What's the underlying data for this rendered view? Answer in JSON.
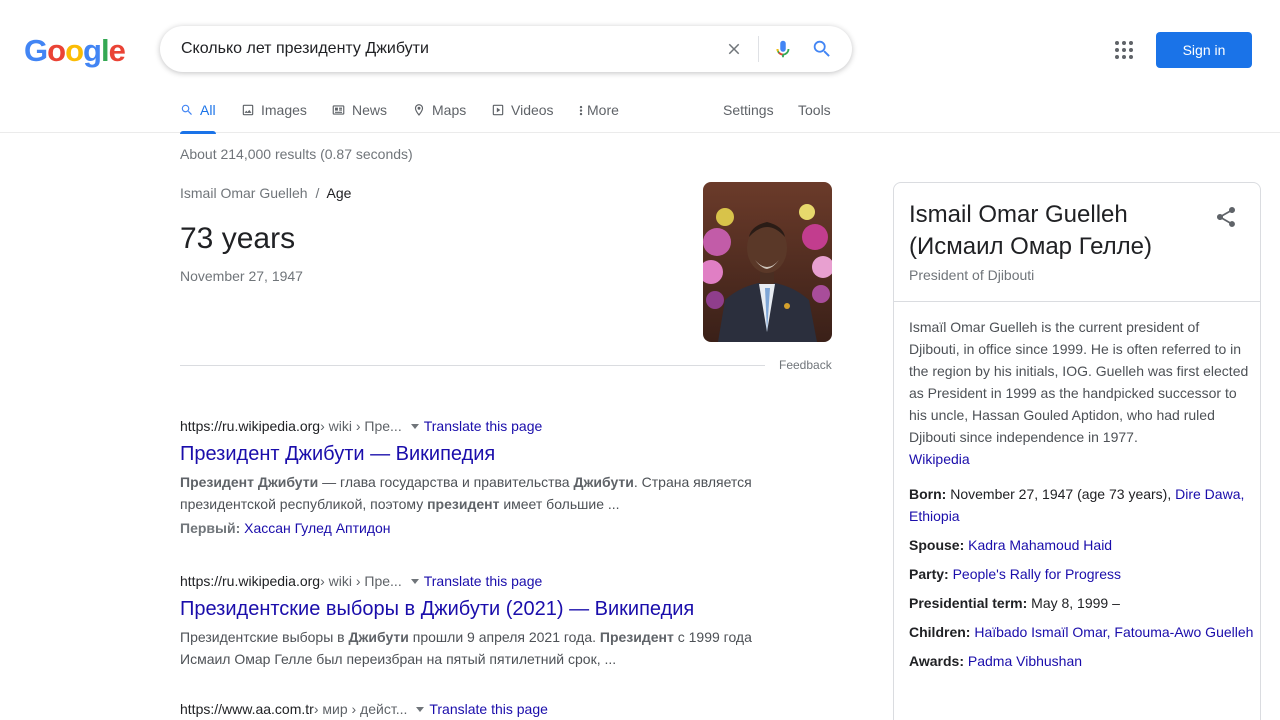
{
  "logo": {
    "text": "Google",
    "colors": [
      "#4285F4",
      "#EA4335",
      "#FBBC05",
      "#4285F4",
      "#34A853",
      "#EA4335"
    ]
  },
  "search": {
    "query": "Сколько лет президенту Джибути"
  },
  "header": {
    "signin_label": "Sign in"
  },
  "tabs": [
    {
      "label": "All",
      "icon": "search-icon",
      "active": true
    },
    {
      "label": "Images",
      "icon": "image-icon"
    },
    {
      "label": "News",
      "icon": "newspaper-icon"
    },
    {
      "label": "Maps",
      "icon": "map-pin-icon"
    },
    {
      "label": "Videos",
      "icon": "play-icon"
    },
    {
      "label": "More",
      "icon": "more-vertical-icon"
    },
    {
      "label": "Settings"
    },
    {
      "label": "Tools"
    }
  ],
  "stats": "About 214,000 results (0.87 seconds)",
  "answer": {
    "entity": "Ismail Omar Guelleh",
    "separator": "/",
    "attribute": "Age",
    "value": "73 years",
    "sub": "November 27, 1947",
    "feedback": "Feedback"
  },
  "results": [
    {
      "domain": "https://ru.wikipedia.org",
      "path": " › wiki › Пре...",
      "translate": "Translate this page",
      "title": "Президент Джибути — Википедия",
      "snippet_parts": [
        {
          "b": "Президент Джибути"
        },
        {
          "t": " — глава государства и правительства "
        },
        {
          "b": "Джибути"
        },
        {
          "t": ". Страна является президентской республикой, поэтому "
        },
        {
          "b": "президент"
        },
        {
          "t": " имеет большие ..."
        }
      ],
      "extra_key": "Первый:",
      "extra_value": "Хассан Гулед Аптидон"
    },
    {
      "domain": "https://ru.wikipedia.org",
      "path": " › wiki › Пре...",
      "translate": "Translate this page",
      "title": "Президентские выборы в Джибути (2021) — Википедия",
      "snippet_parts": [
        {
          "t": "Президентские выборы в "
        },
        {
          "b": "Джибути"
        },
        {
          "t": " прошли 9 апреля 2021 года. "
        },
        {
          "b": "Президент"
        },
        {
          "t": " с 1999 года Исмаил Омар Гелле был переизбран на пятый пятилетний срок, ..."
        }
      ]
    },
    {
      "domain": "https://www.aa.com.tr",
      "path": " › мир › дейст...",
      "translate": "Translate this page"
    }
  ],
  "knowledge_panel": {
    "title_line1": "Ismail Omar Guelleh",
    "title_line2": "(Исмаил Омар Гелле)",
    "subtitle": "President of Djibouti",
    "description": "Ismaïl Omar Guelleh is the current president of Djibouti, in office since 1999. He is often referred to in the region by his initials, IOG. Guelleh was first elected as President in 1999 as the handpicked successor to his uncle, Hassan Gouled Aptidon, who had ruled Djibouti since independence in 1977.",
    "source_link": "Wikipedia",
    "facts": {
      "born": {
        "label": "Born:",
        "text": " November 27, 1947 (age 73 years), ",
        "link": "Dire Dawa, Ethiopia"
      },
      "spouse": {
        "label": "Spouse:",
        "link": "Kadra Mahamoud Haid"
      },
      "party": {
        "label": "Party:",
        "link": "People's Rally for Progress"
      },
      "term": {
        "label": "Presidential term:",
        "text": " May 8, 1999 –"
      },
      "children": {
        "label": "Children:",
        "link": "Haïbado Ismaïl Omar, Fatouma-Awo Guelleh"
      },
      "awards": {
        "label": "Awards:",
        "link": "Padma Vibhushan"
      }
    }
  }
}
